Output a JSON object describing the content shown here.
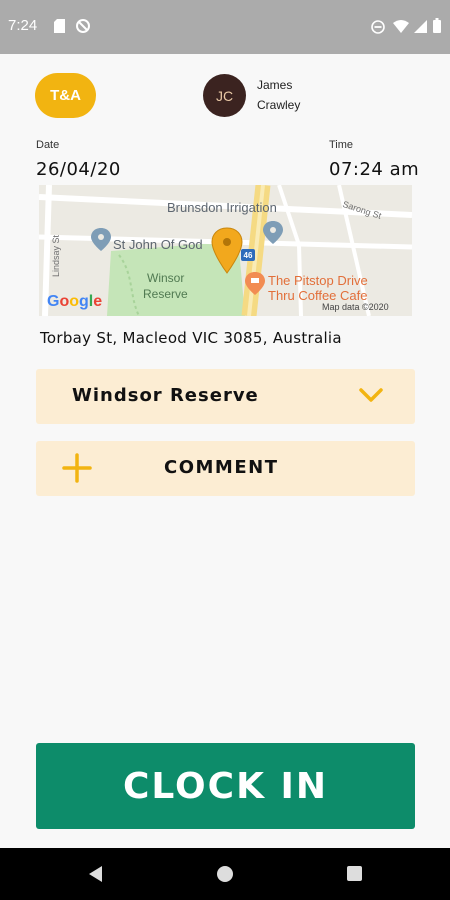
{
  "status_bar": {
    "time": "7:24",
    "left_icons": [
      "sd-card-icon",
      "no-data-icon"
    ],
    "right_icons": [
      "do-not-disturb-icon",
      "wifi-icon",
      "signal-icon",
      "battery-icon"
    ]
  },
  "header": {
    "logo_text": "T&A",
    "avatar_initials": "JC",
    "user_first_name": "James",
    "user_last_name": "Crawley"
  },
  "date": {
    "label": "Date",
    "value": "26/04/20"
  },
  "time": {
    "label": "Time",
    "value": "07:24 am"
  },
  "map": {
    "labels": {
      "irrigation": "Brunsdon Irrigation",
      "church": "St John Of God",
      "reserve_line1": "Winsor",
      "reserve_line2": "Reserve",
      "cafe_line1": "The Pitstop Drive",
      "cafe_line2": "Thru Coffee Cafe",
      "street_sarong": "Sarong St",
      "street_lindsay": "Lindsay St",
      "route_badge": "46"
    },
    "google_logo": "Google",
    "attribution": "Map data ©2020"
  },
  "address": "Torbay St, Macleod VIC 3085, Australia",
  "location_select": {
    "value": "Windsor Reserve"
  },
  "comment_button": {
    "label": "COMMENT"
  },
  "clock_in_button": {
    "label": "CLOCK IN"
  },
  "colors": {
    "brand_yellow": "#f2b411",
    "button_green": "#0d8c6a",
    "panel_cream": "#fcedd3",
    "status_bar_gray": "#ababab"
  },
  "nav_bar": {
    "icons": [
      "back-icon",
      "home-icon",
      "recents-icon"
    ]
  }
}
